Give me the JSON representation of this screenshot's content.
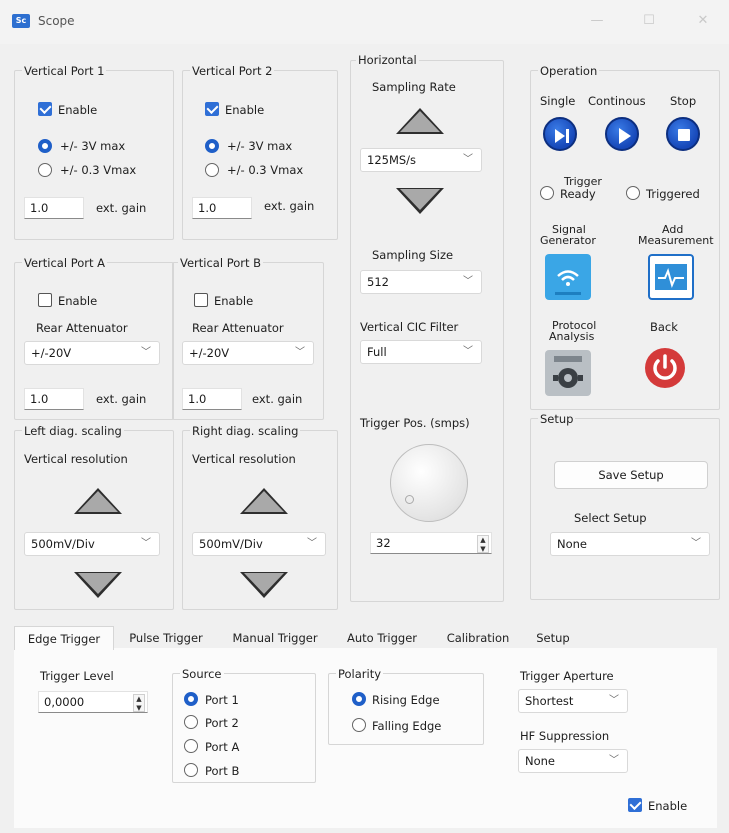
{
  "window": {
    "title": "Scope",
    "app_icon_text": "Sc"
  },
  "vertical_port_1": {
    "title": "Vertical Port 1",
    "enable_label": "Enable",
    "radio_3v": "+/- 3V max",
    "radio_03v": "+/- 0.3 Vmax",
    "gain_value": "1.0",
    "gain_label": "ext. gain"
  },
  "vertical_port_2": {
    "title": "Vertical Port 2",
    "enable_label": "Enable",
    "radio_3v": "+/- 3V max",
    "radio_03v": "+/- 0.3 Vmax",
    "gain_value": "1.0",
    "gain_label": "ext. gain"
  },
  "vertical_port_a": {
    "title": "Vertical Port A",
    "enable_label": "Enable",
    "rear_label": "Rear Attenuator",
    "rear_value": "+/-20V",
    "gain_value": "1.0",
    "gain_label": "ext. gain"
  },
  "vertical_port_b": {
    "title": "Vertical Port B",
    "enable_label": "Enable",
    "rear_label": "Rear Attenuator",
    "rear_value": "+/-20V",
    "gain_value": "1.0",
    "gain_label": "ext. gain"
  },
  "left_diag": {
    "title": "Left diag. scaling",
    "res_label": "Vertical resolution",
    "res_value": "500mV/Div"
  },
  "right_diag": {
    "title": "Right diag. scaling",
    "res_label": "Vertical resolution",
    "res_value": "500mV/Div"
  },
  "horizontal": {
    "title": "Horizontal",
    "sampling_rate_label": "Sampling Rate",
    "sampling_rate_value": "125MS/s",
    "sampling_size_label": "Sampling Size",
    "sampling_size_value": "512",
    "cic_label": "Vertical CIC Filter",
    "cic_value": "Full",
    "trigger_pos_label": "Trigger Pos. (smps)",
    "trigger_pos_value": "32"
  },
  "operation": {
    "title": "Operation",
    "single_label": "Single",
    "continuous_label": "Continous",
    "stop_label": "Stop",
    "trigger_label_top": "Trigger",
    "trigger_ready_label": "Ready",
    "triggered_label": "Triggered",
    "signal_gen_line1": "Signal",
    "signal_gen_line2": "Generator",
    "add_meas_line1": "Add",
    "add_meas_line2": "Measurement",
    "protocol_line1": "Protocol",
    "protocol_line2": "Analysis",
    "back_label": "Back"
  },
  "setup": {
    "title": "Setup",
    "save_label": "Save Setup",
    "select_label": "Select Setup",
    "select_value": "None"
  },
  "tabs": [
    "Edge Trigger",
    "Pulse Trigger",
    "Manual Trigger",
    "Auto Trigger",
    "Calibration",
    "Setup"
  ],
  "edge_trigger": {
    "level_label": "Trigger Level",
    "level_value": "0,0000",
    "source_title": "Source",
    "sources": [
      "Port 1",
      "Port 2",
      "Port A",
      "Port B"
    ],
    "polarity_title": "Polarity",
    "rising_label": "Rising Edge",
    "falling_label": "Falling Edge",
    "aperture_label": "Trigger Aperture",
    "aperture_value": "Shortest",
    "hf_label": "HF Suppression",
    "hf_value": "None",
    "enable_label": "Enable"
  },
  "colors": {
    "accent": "#1f5fc8",
    "cyan_tile": "#3aa6e6",
    "back_red": "#d43a3a"
  }
}
